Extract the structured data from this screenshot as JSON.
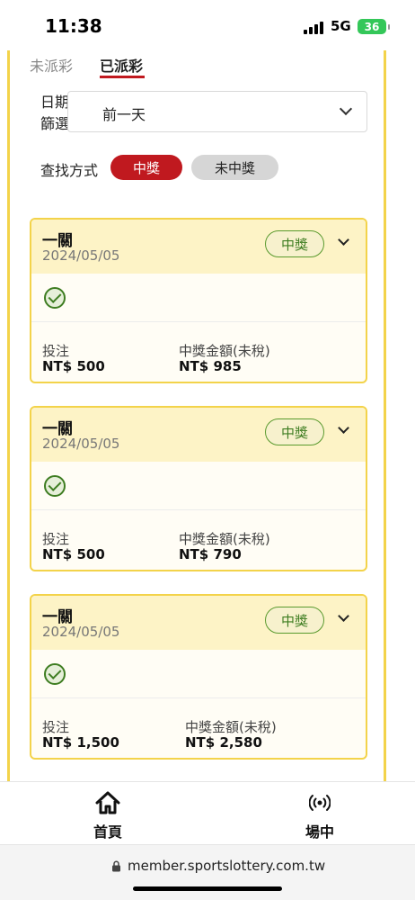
{
  "status_bar": {
    "time": "11:38",
    "network": "5G",
    "battery": "36"
  },
  "tabs": {
    "unpaid": "未派彩",
    "paid": "已派彩",
    "active": "已派彩"
  },
  "date_filter": {
    "label": "日期篩選",
    "value": "前一天"
  },
  "search_method": {
    "label": "查找方式",
    "win": "中獎",
    "lose": "未中獎",
    "active": "中獎"
  },
  "cards": [
    {
      "title": "一關",
      "date": "2024/05/05",
      "badge": "中獎",
      "bet_label": "投注",
      "bet_value": "NT$ 500",
      "prize_label": "中獎金額(未稅)",
      "prize_value": "NT$ 985"
    },
    {
      "title": "一關",
      "date": "2024/05/05",
      "badge": "中獎",
      "bet_label": "投注",
      "bet_value": "NT$ 500",
      "prize_label": "中獎金額(未稅)",
      "prize_value": "NT$ 790"
    },
    {
      "title": "一關",
      "date": "2024/05/05",
      "badge": "中獎",
      "bet_label": "投注",
      "bet_value": "NT$ 1,500",
      "prize_label": "中獎金額(未稅)",
      "prize_value": "NT$ 2,580"
    }
  ],
  "bottom_nav": {
    "home": "首頁",
    "live": "場中"
  },
  "url_bar": {
    "url": "member.sportslottery.com.tw"
  },
  "colors": {
    "accent_red": "#c0191f",
    "border_yellow": "#f3d34a",
    "win_green": "#3e7d21"
  },
  "icons": {
    "home": "home-icon",
    "live": "broadcast-icon",
    "lock": "lock-icon",
    "check": "check-circle-icon",
    "chevron": "chevron-down-icon"
  }
}
